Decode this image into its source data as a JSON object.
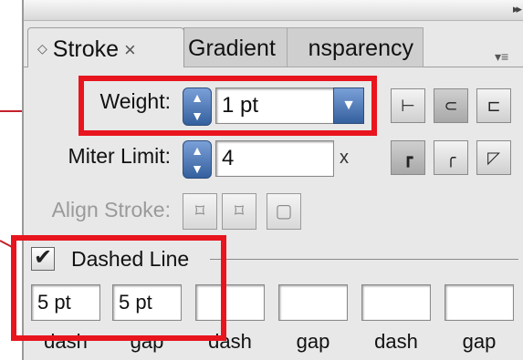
{
  "panel": {
    "tabs": [
      {
        "label": "Stroke",
        "close": "×"
      },
      {
        "label": "Gradient"
      },
      {
        "label": "nsparency"
      }
    ]
  },
  "weight": {
    "label": "Weight:",
    "value": "1 pt"
  },
  "miter": {
    "label": "Miter Limit:",
    "value": "4",
    "suffix": "x"
  },
  "align": {
    "label": "Align Stroke:"
  },
  "dashed": {
    "label": "Dashed Line",
    "checked": true,
    "fields": [
      {
        "value": "5 pt",
        "label": "dash"
      },
      {
        "value": "5 pt",
        "label": "gap"
      },
      {
        "value": "",
        "label": "dash"
      },
      {
        "value": "",
        "label": "gap"
      },
      {
        "value": "",
        "label": "dash"
      },
      {
        "value": "",
        "label": "gap"
      }
    ]
  },
  "colors": {
    "highlight": "#e8141e",
    "spinner": "#4a74b4",
    "panel": "#e8e8e8"
  },
  "icons": [
    "tab-diamond-icon",
    "spinner-arrows-icon",
    "dropdown-arrow-icon",
    "cap-butt-icon",
    "cap-round-icon",
    "cap-square-icon",
    "join-miter-icon",
    "join-round-icon",
    "join-bevel-icon",
    "align-center-icon",
    "align-inside-icon",
    "align-outside-icon",
    "checkmark-icon"
  ]
}
